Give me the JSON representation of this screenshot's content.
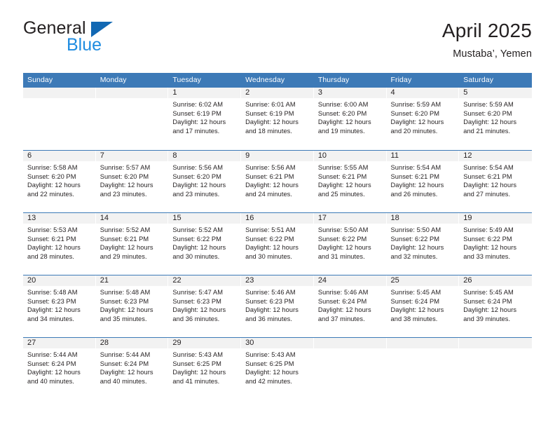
{
  "brand": {
    "name_part1": "General",
    "name_part2": "Blue",
    "logo_icon": "flag-triangle-icon",
    "accent_color": "#1268b3",
    "accent_color_light": "#1f8ce0"
  },
  "header": {
    "title": "April 2025",
    "subtitle": "Mustaba’, Yemen"
  },
  "calendar": {
    "header_bg": "#3d7ab7",
    "daynum_band_bg": "#f2f2f2",
    "weekdays": [
      "Sunday",
      "Monday",
      "Tuesday",
      "Wednesday",
      "Thursday",
      "Friday",
      "Saturday"
    ],
    "weeks": [
      [
        {
          "day": "",
          "lines": []
        },
        {
          "day": "",
          "lines": []
        },
        {
          "day": "1",
          "lines": [
            "Sunrise: 6:02 AM",
            "Sunset: 6:19 PM",
            "Daylight: 12 hours",
            "and 17 minutes."
          ]
        },
        {
          "day": "2",
          "lines": [
            "Sunrise: 6:01 AM",
            "Sunset: 6:19 PM",
            "Daylight: 12 hours",
            "and 18 minutes."
          ]
        },
        {
          "day": "3",
          "lines": [
            "Sunrise: 6:00 AM",
            "Sunset: 6:20 PM",
            "Daylight: 12 hours",
            "and 19 minutes."
          ]
        },
        {
          "day": "4",
          "lines": [
            "Sunrise: 5:59 AM",
            "Sunset: 6:20 PM",
            "Daylight: 12 hours",
            "and 20 minutes."
          ]
        },
        {
          "day": "5",
          "lines": [
            "Sunrise: 5:59 AM",
            "Sunset: 6:20 PM",
            "Daylight: 12 hours",
            "and 21 minutes."
          ]
        }
      ],
      [
        {
          "day": "6",
          "lines": [
            "Sunrise: 5:58 AM",
            "Sunset: 6:20 PM",
            "Daylight: 12 hours",
            "and 22 minutes."
          ]
        },
        {
          "day": "7",
          "lines": [
            "Sunrise: 5:57 AM",
            "Sunset: 6:20 PM",
            "Daylight: 12 hours",
            "and 23 minutes."
          ]
        },
        {
          "day": "8",
          "lines": [
            "Sunrise: 5:56 AM",
            "Sunset: 6:20 PM",
            "Daylight: 12 hours",
            "and 23 minutes."
          ]
        },
        {
          "day": "9",
          "lines": [
            "Sunrise: 5:56 AM",
            "Sunset: 6:21 PM",
            "Daylight: 12 hours",
            "and 24 minutes."
          ]
        },
        {
          "day": "10",
          "lines": [
            "Sunrise: 5:55 AM",
            "Sunset: 6:21 PM",
            "Daylight: 12 hours",
            "and 25 minutes."
          ]
        },
        {
          "day": "11",
          "lines": [
            "Sunrise: 5:54 AM",
            "Sunset: 6:21 PM",
            "Daylight: 12 hours",
            "and 26 minutes."
          ]
        },
        {
          "day": "12",
          "lines": [
            "Sunrise: 5:54 AM",
            "Sunset: 6:21 PM",
            "Daylight: 12 hours",
            "and 27 minutes."
          ]
        }
      ],
      [
        {
          "day": "13",
          "lines": [
            "Sunrise: 5:53 AM",
            "Sunset: 6:21 PM",
            "Daylight: 12 hours",
            "and 28 minutes."
          ]
        },
        {
          "day": "14",
          "lines": [
            "Sunrise: 5:52 AM",
            "Sunset: 6:21 PM",
            "Daylight: 12 hours",
            "and 29 minutes."
          ]
        },
        {
          "day": "15",
          "lines": [
            "Sunrise: 5:52 AM",
            "Sunset: 6:22 PM",
            "Daylight: 12 hours",
            "and 30 minutes."
          ]
        },
        {
          "day": "16",
          "lines": [
            "Sunrise: 5:51 AM",
            "Sunset: 6:22 PM",
            "Daylight: 12 hours",
            "and 30 minutes."
          ]
        },
        {
          "day": "17",
          "lines": [
            "Sunrise: 5:50 AM",
            "Sunset: 6:22 PM",
            "Daylight: 12 hours",
            "and 31 minutes."
          ]
        },
        {
          "day": "18",
          "lines": [
            "Sunrise: 5:50 AM",
            "Sunset: 6:22 PM",
            "Daylight: 12 hours",
            "and 32 minutes."
          ]
        },
        {
          "day": "19",
          "lines": [
            "Sunrise: 5:49 AM",
            "Sunset: 6:22 PM",
            "Daylight: 12 hours",
            "and 33 minutes."
          ]
        }
      ],
      [
        {
          "day": "20",
          "lines": [
            "Sunrise: 5:48 AM",
            "Sunset: 6:23 PM",
            "Daylight: 12 hours",
            "and 34 minutes."
          ]
        },
        {
          "day": "21",
          "lines": [
            "Sunrise: 5:48 AM",
            "Sunset: 6:23 PM",
            "Daylight: 12 hours",
            "and 35 minutes."
          ]
        },
        {
          "day": "22",
          "lines": [
            "Sunrise: 5:47 AM",
            "Sunset: 6:23 PM",
            "Daylight: 12 hours",
            "and 36 minutes."
          ]
        },
        {
          "day": "23",
          "lines": [
            "Sunrise: 5:46 AM",
            "Sunset: 6:23 PM",
            "Daylight: 12 hours",
            "and 36 minutes."
          ]
        },
        {
          "day": "24",
          "lines": [
            "Sunrise: 5:46 AM",
            "Sunset: 6:24 PM",
            "Daylight: 12 hours",
            "and 37 minutes."
          ]
        },
        {
          "day": "25",
          "lines": [
            "Sunrise: 5:45 AM",
            "Sunset: 6:24 PM",
            "Daylight: 12 hours",
            "and 38 minutes."
          ]
        },
        {
          "day": "26",
          "lines": [
            "Sunrise: 5:45 AM",
            "Sunset: 6:24 PM",
            "Daylight: 12 hours",
            "and 39 minutes."
          ]
        }
      ],
      [
        {
          "day": "27",
          "lines": [
            "Sunrise: 5:44 AM",
            "Sunset: 6:24 PM",
            "Daylight: 12 hours",
            "and 40 minutes."
          ]
        },
        {
          "day": "28",
          "lines": [
            "Sunrise: 5:44 AM",
            "Sunset: 6:24 PM",
            "Daylight: 12 hours",
            "and 40 minutes."
          ]
        },
        {
          "day": "29",
          "lines": [
            "Sunrise: 5:43 AM",
            "Sunset: 6:25 PM",
            "Daylight: 12 hours",
            "and 41 minutes."
          ]
        },
        {
          "day": "30",
          "lines": [
            "Sunrise: 5:43 AM",
            "Sunset: 6:25 PM",
            "Daylight: 12 hours",
            "and 42 minutes."
          ]
        },
        {
          "day": "",
          "lines": []
        },
        {
          "day": "",
          "lines": []
        },
        {
          "day": "",
          "lines": []
        }
      ]
    ]
  }
}
